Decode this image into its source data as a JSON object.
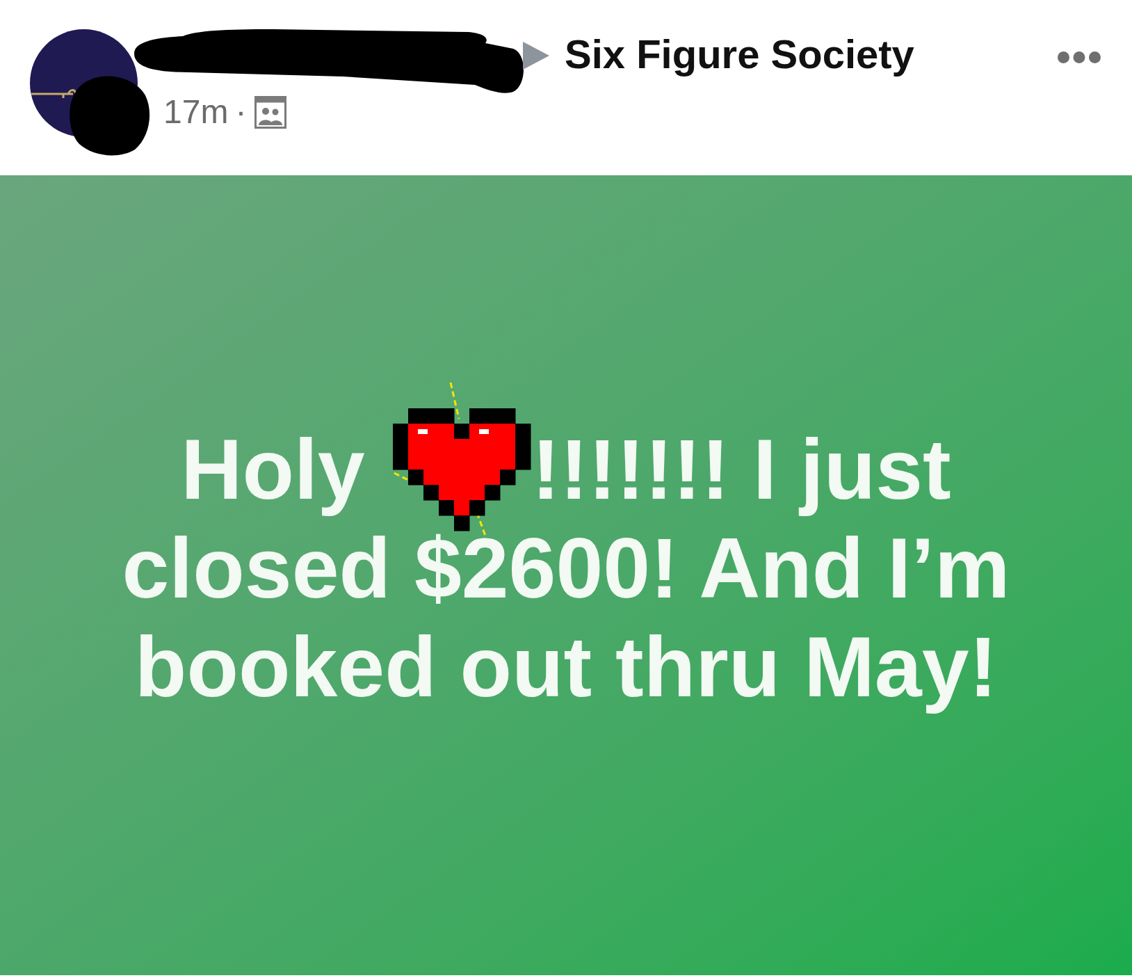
{
  "post_header": {
    "group_name": "Six Figure Society",
    "time": "17m",
    "separator": "·"
  },
  "post_body": {
    "lines": [
      [
        {
          "kind": "text",
          "text": "Holy"
        },
        {
          "kind": "sticker"
        },
        {
          "kind": "text",
          "text": "!!!!!!! I just"
        }
      ],
      [
        {
          "kind": "text",
          "text": "closed $2600! And I’m"
        }
      ],
      [
        {
          "kind": "text",
          "text": "booked out thru May!"
        }
      ]
    ]
  }
}
